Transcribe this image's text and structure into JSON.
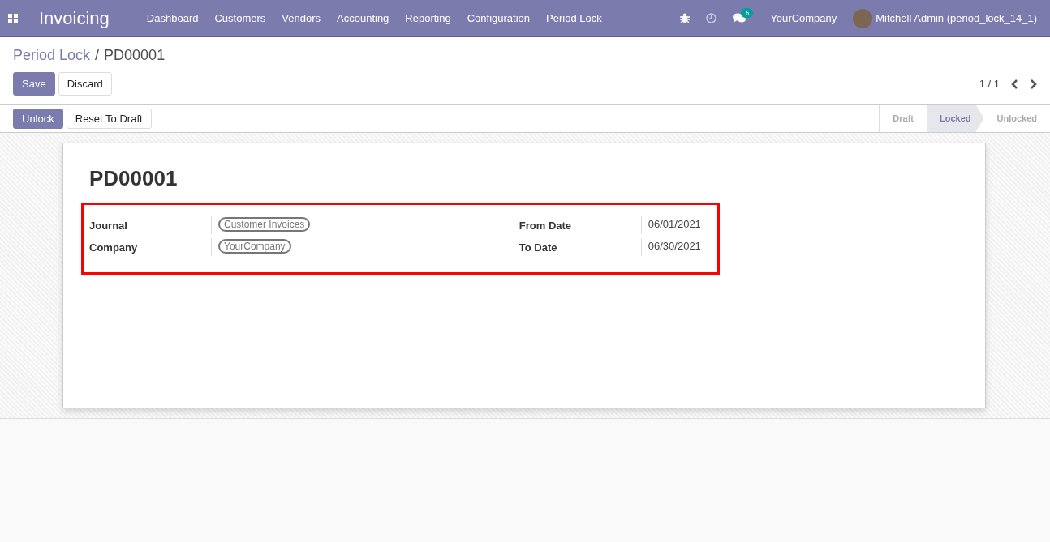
{
  "navbar": {
    "app_name": "Invoicing",
    "menu": [
      "Dashboard",
      "Customers",
      "Vendors",
      "Accounting",
      "Reporting",
      "Configuration",
      "Period Lock"
    ],
    "message_count": "5",
    "company": "YourCompany",
    "user": "Mitchell Admin (period_lock_14_1)"
  },
  "breadcrumb": {
    "parent": "Period Lock",
    "separator": "/",
    "current": "PD00001"
  },
  "actions": [
    {
      "label": "Save",
      "kind": "primary"
    },
    {
      "label": "Discard",
      "kind": "secondary"
    }
  ],
  "pager": {
    "text": "1 / 1"
  },
  "header_buttons": [
    {
      "label": "Unlock",
      "kind": "primary"
    },
    {
      "label": "Reset To Draft",
      "kind": "secondary"
    }
  ],
  "stages": [
    {
      "label": "Draft",
      "selected": false
    },
    {
      "label": "Locked",
      "selected": true
    },
    {
      "label": "Unlocked",
      "selected": false
    }
  ],
  "record": {
    "title": "PD00001",
    "left_fields": [
      {
        "label": "Journal",
        "value": "Customer Invoices",
        "kind": "tag"
      },
      {
        "label": "Company",
        "value": "YourCompany",
        "kind": "tag"
      }
    ],
    "right_fields": [
      {
        "label": "From Date",
        "value": "06/01/2021",
        "kind": "text"
      },
      {
        "label": "To Date",
        "value": "06/30/2021",
        "kind": "text"
      }
    ]
  }
}
